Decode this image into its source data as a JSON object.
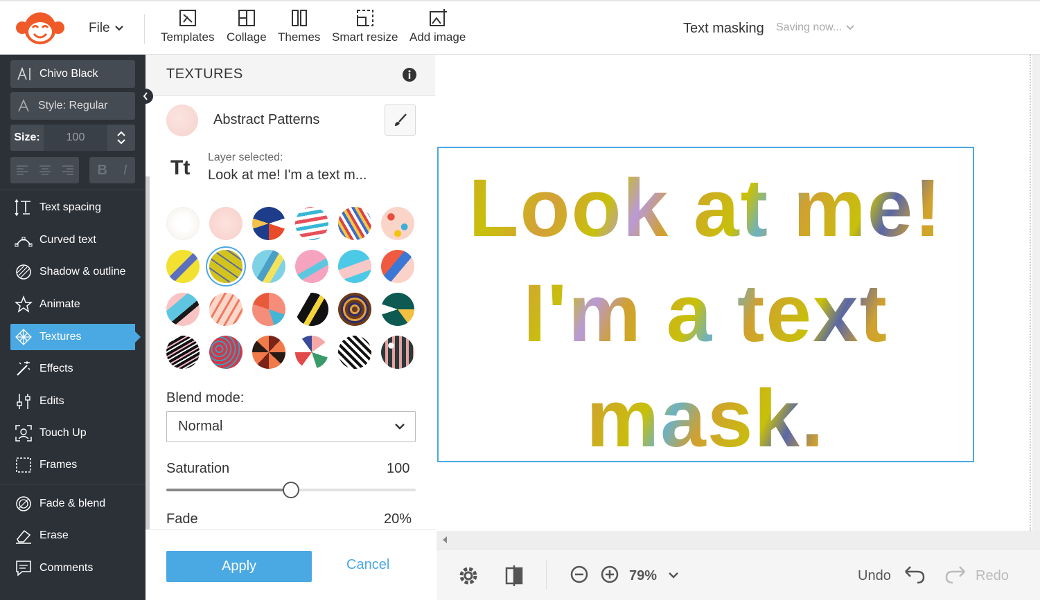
{
  "header": {
    "file_label": "File",
    "tools": [
      {
        "label": "Templates",
        "icon": "templates-icon"
      },
      {
        "label": "Collage",
        "icon": "collage-icon"
      },
      {
        "label": "Themes",
        "icon": "themes-icon"
      },
      {
        "label": "Smart resize",
        "icon": "smart-resize-icon"
      },
      {
        "label": "Add image",
        "icon": "add-image-icon"
      }
    ],
    "doc_title": "Text masking",
    "status": "Saving now..."
  },
  "sidebar": {
    "font": "Chivo Black",
    "style": "Style: Regular",
    "size_label": "Size:",
    "size_value": "100",
    "bold_label": "B",
    "italic_label": "I",
    "items": [
      {
        "label": "Text spacing",
        "icon": "text-spacing-icon"
      },
      {
        "label": "Curved text",
        "icon": "curved-text-icon"
      },
      {
        "label": "Shadow & outline",
        "icon": "shadow-outline-icon"
      },
      {
        "label": "Animate",
        "icon": "animate-icon"
      },
      {
        "label": "Textures",
        "icon": "textures-icon",
        "active": true
      },
      {
        "label": "Effects",
        "icon": "effects-icon"
      },
      {
        "label": "Edits",
        "icon": "edits-icon"
      },
      {
        "label": "Touch Up",
        "icon": "touch-up-icon"
      },
      {
        "label": "Frames",
        "icon": "frames-icon"
      },
      {
        "label": "Fade & blend",
        "icon": "fade-blend-icon"
      },
      {
        "label": "Erase",
        "icon": "erase-icon"
      },
      {
        "label": "Comments",
        "icon": "comments-icon"
      }
    ]
  },
  "panel": {
    "title": "TEXTURES",
    "texture_name": "Abstract Patterns",
    "layer_icon": "Tt",
    "layer_label": "Layer selected:",
    "layer_value": "Look at me! I'm a text m...",
    "blend_label": "Blend mode:",
    "blend_value": "Normal",
    "saturation_label": "Saturation",
    "saturation_value": "100",
    "saturation_fraction": 0.5,
    "fade_label": "Fade",
    "fade_value": "20%",
    "apply_label": "Apply",
    "cancel_label": "Cancel",
    "selected_swatch_index": 7
  },
  "canvas": {
    "text_line1": "Look at me!",
    "text_line2": "I'm a text",
    "text_line3": "mask."
  },
  "bottom": {
    "zoom": "79%",
    "undo_label": "Undo",
    "redo_label": "Redo"
  },
  "colors": {
    "accent": "#4aa8e3",
    "sidebar_bg": "#2c3138",
    "logo": "#f05a28"
  }
}
